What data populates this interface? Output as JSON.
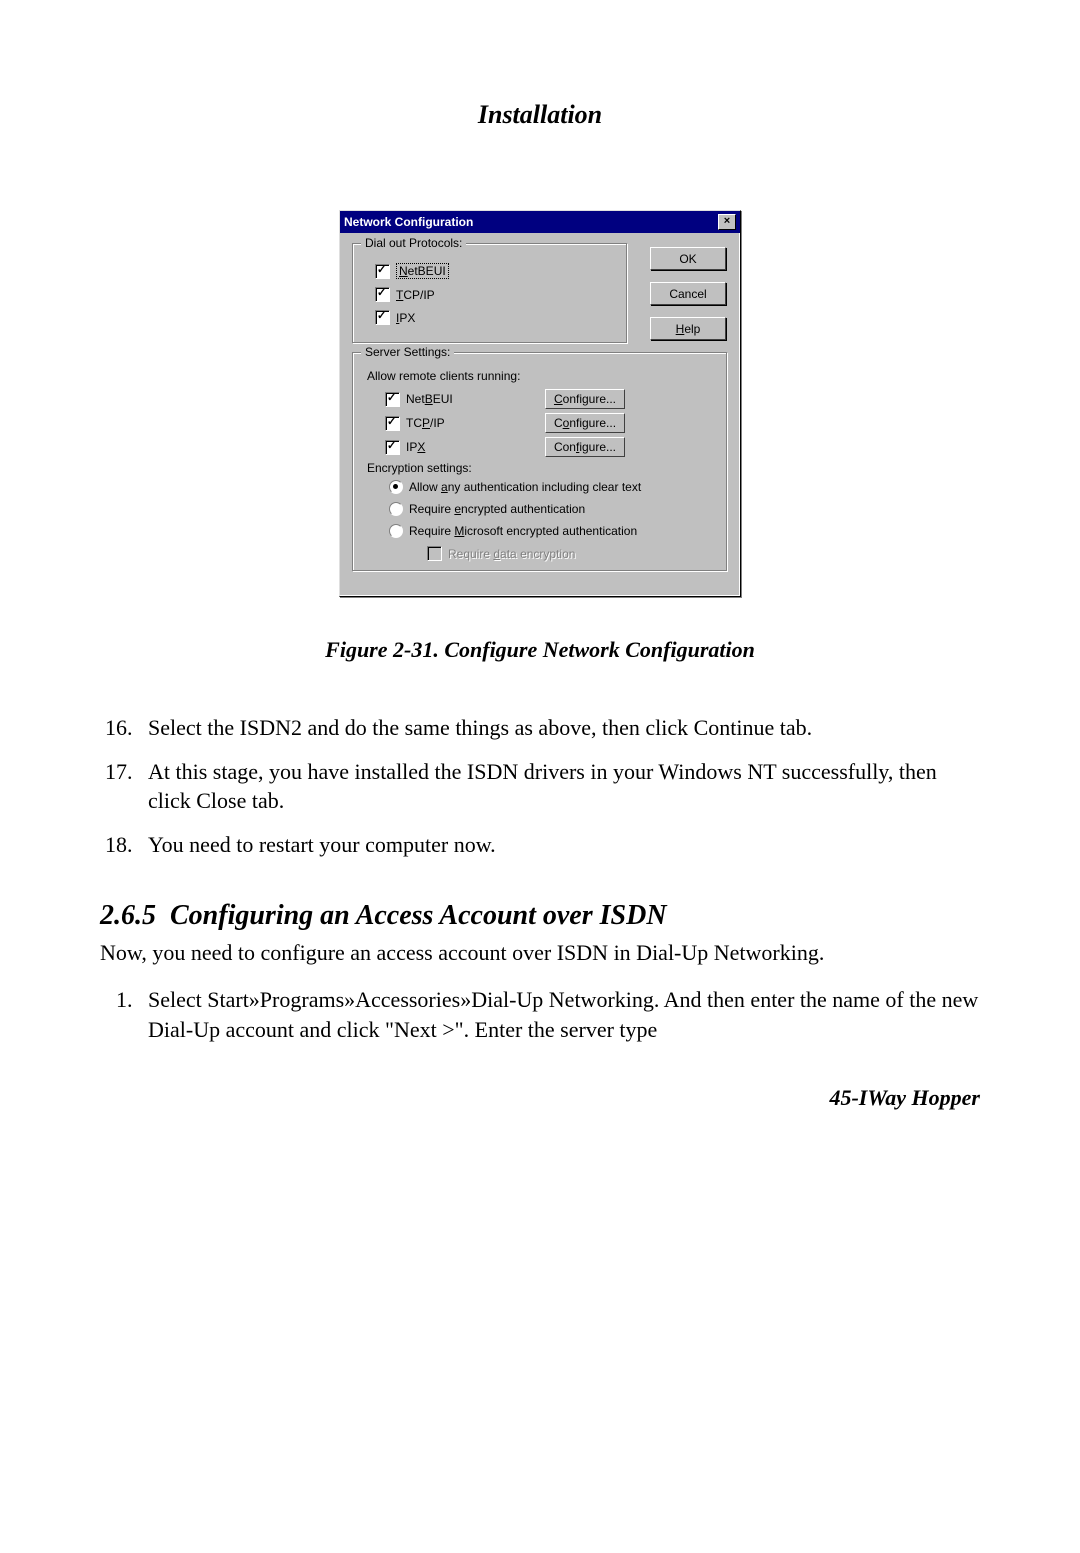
{
  "page_header": "Installation",
  "dialog": {
    "title": "Network Configuration",
    "close_x": "×",
    "buttons": {
      "ok": "OK",
      "cancel": "Cancel",
      "help_pre": "",
      "help_u": "H",
      "help_post": "elp"
    },
    "dialout": {
      "legend": "Dial out Protocols:",
      "netbeui_u": "N",
      "netbeui_post": "etBEUI",
      "tcpip_u": "T",
      "tcpip_post": "CP/IP",
      "ipx_u": "I",
      "ipx_post": "PX"
    },
    "server": {
      "legend": "Server Settings:",
      "allow_text": "Allow remote clients running:",
      "netbeui_pre": "Net",
      "netbeui_u": "B",
      "netbeui_post": "EUI",
      "tcpip_pre": "TC",
      "tcpip_u": "P",
      "tcpip_post": "/IP",
      "ipx_pre": "IP",
      "ipx_u": "X",
      "ipx_post": "",
      "cfg1_u": "C",
      "cfg1_post": "onfigure...",
      "cfg2_pre": "C",
      "cfg2_u": "o",
      "cfg2_post": "nfigure...",
      "cfg3_pre": "Con",
      "cfg3_u": "f",
      "cfg3_post": "igure..."
    },
    "enc": {
      "label": "Encryption settings:",
      "r1_pre": "Allow ",
      "r1_u": "a",
      "r1_post": "ny authentication including clear text",
      "r2_pre": "Require ",
      "r2_u": "e",
      "r2_post": "ncrypted authentication",
      "r3_pre": "Require ",
      "r3_u": "M",
      "r3_post": "icrosoft encrypted authentication",
      "d_pre": "Require ",
      "d_u": "d",
      "d_post": "ata encryption"
    }
  },
  "figure_caption": "Figure 2-31. Configure Network Configuration",
  "steps_a": [
    "Select the ISDN2 and do the same things as above, then click Continue tab.",
    "At this stage, you have installed the ISDN drivers in your Windows NT successfully, then click Close tab.",
    "You need to restart your computer now."
  ],
  "section": {
    "number": "2.6.5",
    "title": "Configuring an Access Account over ISDN"
  },
  "intro_para": "Now, you need to configure an access account over ISDN in Dial-Up Networking.",
  "steps_b": [
    "Select Start»Programs»Accessories»Dial-Up Networking.  And then enter the name of the new Dial-Up account and click \"Next >\".  Enter the server type"
  ],
  "footer": "45-IWay Hopper"
}
